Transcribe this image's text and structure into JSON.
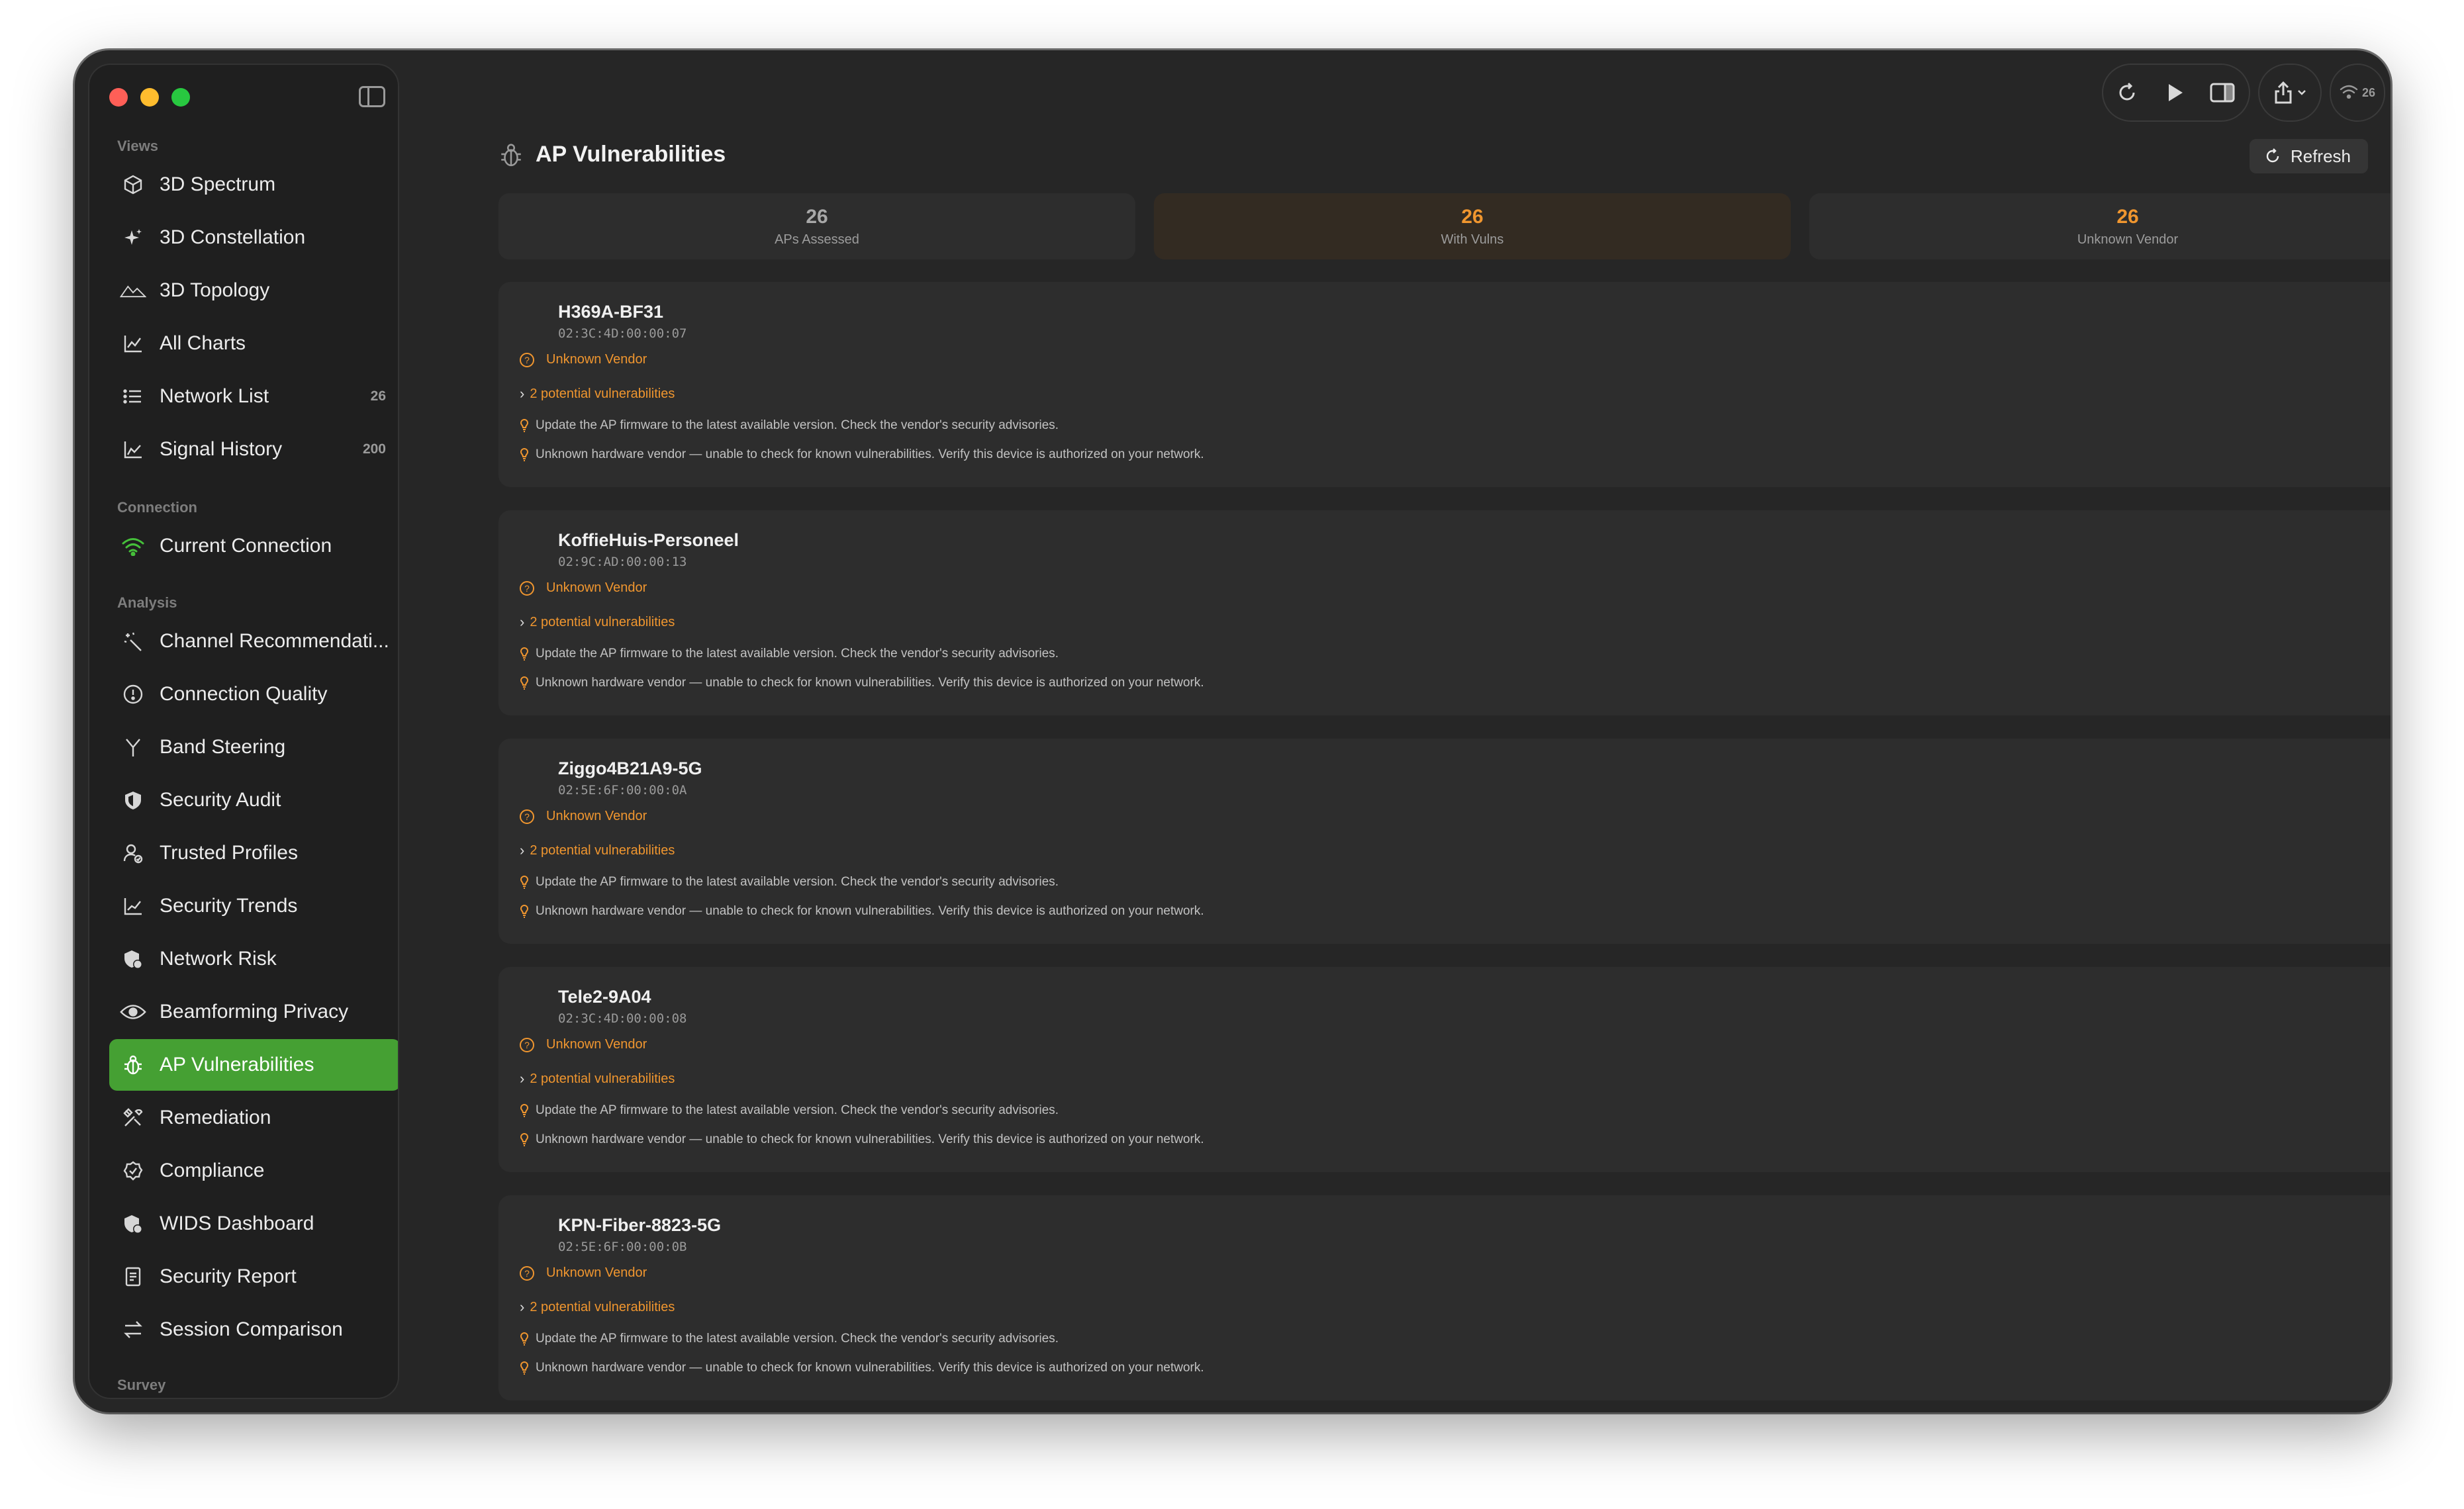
{
  "sidebar": {
    "sections": {
      "views": "Views",
      "connection": "Connection",
      "analysis": "Analysis",
      "survey": "Survey"
    },
    "items": [
      {
        "label": "3D Spectrum",
        "icon": "cube-icon"
      },
      {
        "label": "3D Constellation",
        "icon": "sparkles-icon"
      },
      {
        "label": "3D Topology",
        "icon": "mountains-icon"
      },
      {
        "label": "All Charts",
        "icon": "line-chart-icon"
      },
      {
        "label": "Network List",
        "icon": "list-icon",
        "count": "26"
      },
      {
        "label": "Signal History",
        "icon": "chart-history-icon",
        "count": "200"
      },
      {
        "label": "Current Connection",
        "icon": "wifi-icon"
      },
      {
        "label": "Channel Recommendati...",
        "icon": "wand-icon"
      },
      {
        "label": "Connection Quality",
        "icon": "gauge-icon"
      },
      {
        "label": "Band Steering",
        "icon": "split-arrows-icon"
      },
      {
        "label": "Security Audit",
        "icon": "shield-icon"
      },
      {
        "label": "Trusted Profiles",
        "icon": "person-check-icon"
      },
      {
        "label": "Security Trends",
        "icon": "trend-chart-icon"
      },
      {
        "label": "Network Risk",
        "icon": "shield-alert-icon"
      },
      {
        "label": "Beamforming Privacy",
        "icon": "eye-icon"
      },
      {
        "label": "AP Vulnerabilities",
        "icon": "ladybug-icon",
        "active": true
      },
      {
        "label": "Remediation",
        "icon": "tools-icon"
      },
      {
        "label": "Compliance",
        "icon": "checkmark-seal-icon"
      },
      {
        "label": "WIDS Dashboard",
        "icon": "shield-person-icon"
      },
      {
        "label": "Security Report",
        "icon": "document-icon"
      },
      {
        "label": "Session Comparison",
        "icon": "arrows-swap-icon"
      }
    ]
  },
  "toolbar": {
    "network_count": "26"
  },
  "main": {
    "title": "AP Vulnerabilities",
    "refresh_label": "Refresh",
    "stats": [
      {
        "value": "26",
        "label": "APs Assessed"
      },
      {
        "value": "26",
        "label": "With Vulns"
      },
      {
        "value": "26",
        "label": "Unknown Vendor"
      }
    ],
    "aps": [
      {
        "name": "H369A-BF31",
        "mac": "02:3C:4D:00:00:07",
        "vendor": "Unknown Vendor",
        "vulns": "2 potential vulnerabilities",
        "recs": [
          "Update the AP firmware to the latest available version. Check the vendor's security advisories.",
          "Unknown hardware vendor — unable to check for known vulnerabilities. Verify this device is authorized on your network."
        ]
      },
      {
        "name": "KoffieHuis-Personeel",
        "mac": "02:9C:AD:00:00:13",
        "vendor": "Unknown Vendor",
        "vulns": "2 potential vulnerabilities",
        "recs": [
          "Update the AP firmware to the latest available version. Check the vendor's security advisories.",
          "Unknown hardware vendor — unable to check for known vulnerabilities. Verify this device is authorized on your network."
        ]
      },
      {
        "name": "Ziggo4B21A9-5G",
        "mac": "02:5E:6F:00:00:0A",
        "vendor": "Unknown Vendor",
        "vulns": "2 potential vulnerabilities",
        "recs": [
          "Update the AP firmware to the latest available version. Check the vendor's security advisories.",
          "Unknown hardware vendor — unable to check for known vulnerabilities. Verify this device is authorized on your network."
        ]
      },
      {
        "name": "Tele2-9A04",
        "mac": "02:3C:4D:00:00:08",
        "vendor": "Unknown Vendor",
        "vulns": "2 potential vulnerabilities",
        "recs": [
          "Update the AP firmware to the latest available version. Check the vendor's security advisories.",
          "Unknown hardware vendor — unable to check for known vulnerabilities. Verify this device is authorized on your network."
        ]
      },
      {
        "name": "KPN-Fiber-8823-5G",
        "mac": "02:5E:6F:00:00:0B",
        "vendor": "Unknown Vendor",
        "vulns": "2 potential vulnerabilities",
        "recs": [
          "Update the AP firmware to the latest available version. Check the vendor's security advisories.",
          "Unknown hardware vendor — unable to check for known vulnerabilities. Verify this device is authorized on your network."
        ]
      }
    ]
  },
  "colors": {
    "accent_green": "#45a033",
    "warning_orange": "#f0962f",
    "background": "#262626"
  }
}
